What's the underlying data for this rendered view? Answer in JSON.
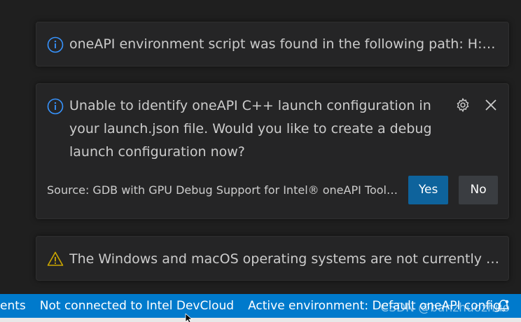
{
  "notifications": [
    {
      "type": "info",
      "icon": "info-icon",
      "message": "oneAPI environment script was found in the following path: H:\\Intel\\o..."
    },
    {
      "type": "info",
      "icon": "info-icon",
      "message": "Unable to identify oneAPI C++ launch configuration in your launch.json file. Would you like to create a debug launch configuration now?",
      "source": "Source: GDB with GPU Debug Support for Intel® oneAPI Toolk...",
      "actions": {
        "settings_icon": "gear-icon",
        "close_icon": "close-icon",
        "yes_label": "Yes",
        "no_label": "No"
      }
    },
    {
      "type": "warning",
      "icon": "warning-icon",
      "message": "The Windows and macOS operating systems are not currently support..."
    }
  ],
  "statusbar": {
    "items": [
      "ents",
      "Not connected to Intel DevCloud",
      "Active environment: Default oneAPI config"
    ],
    "notification_icon": "bell-icon",
    "watermark": "CSDN @banzhuozhuo"
  },
  "colors": {
    "background": "#1f1f1f",
    "toast_background": "#252526",
    "info_accent": "#3794ff",
    "warning_accent": "#cca700",
    "primary_button": "#0e639c",
    "secondary_button": "#3a3d41",
    "statusbar": "#007acc"
  }
}
